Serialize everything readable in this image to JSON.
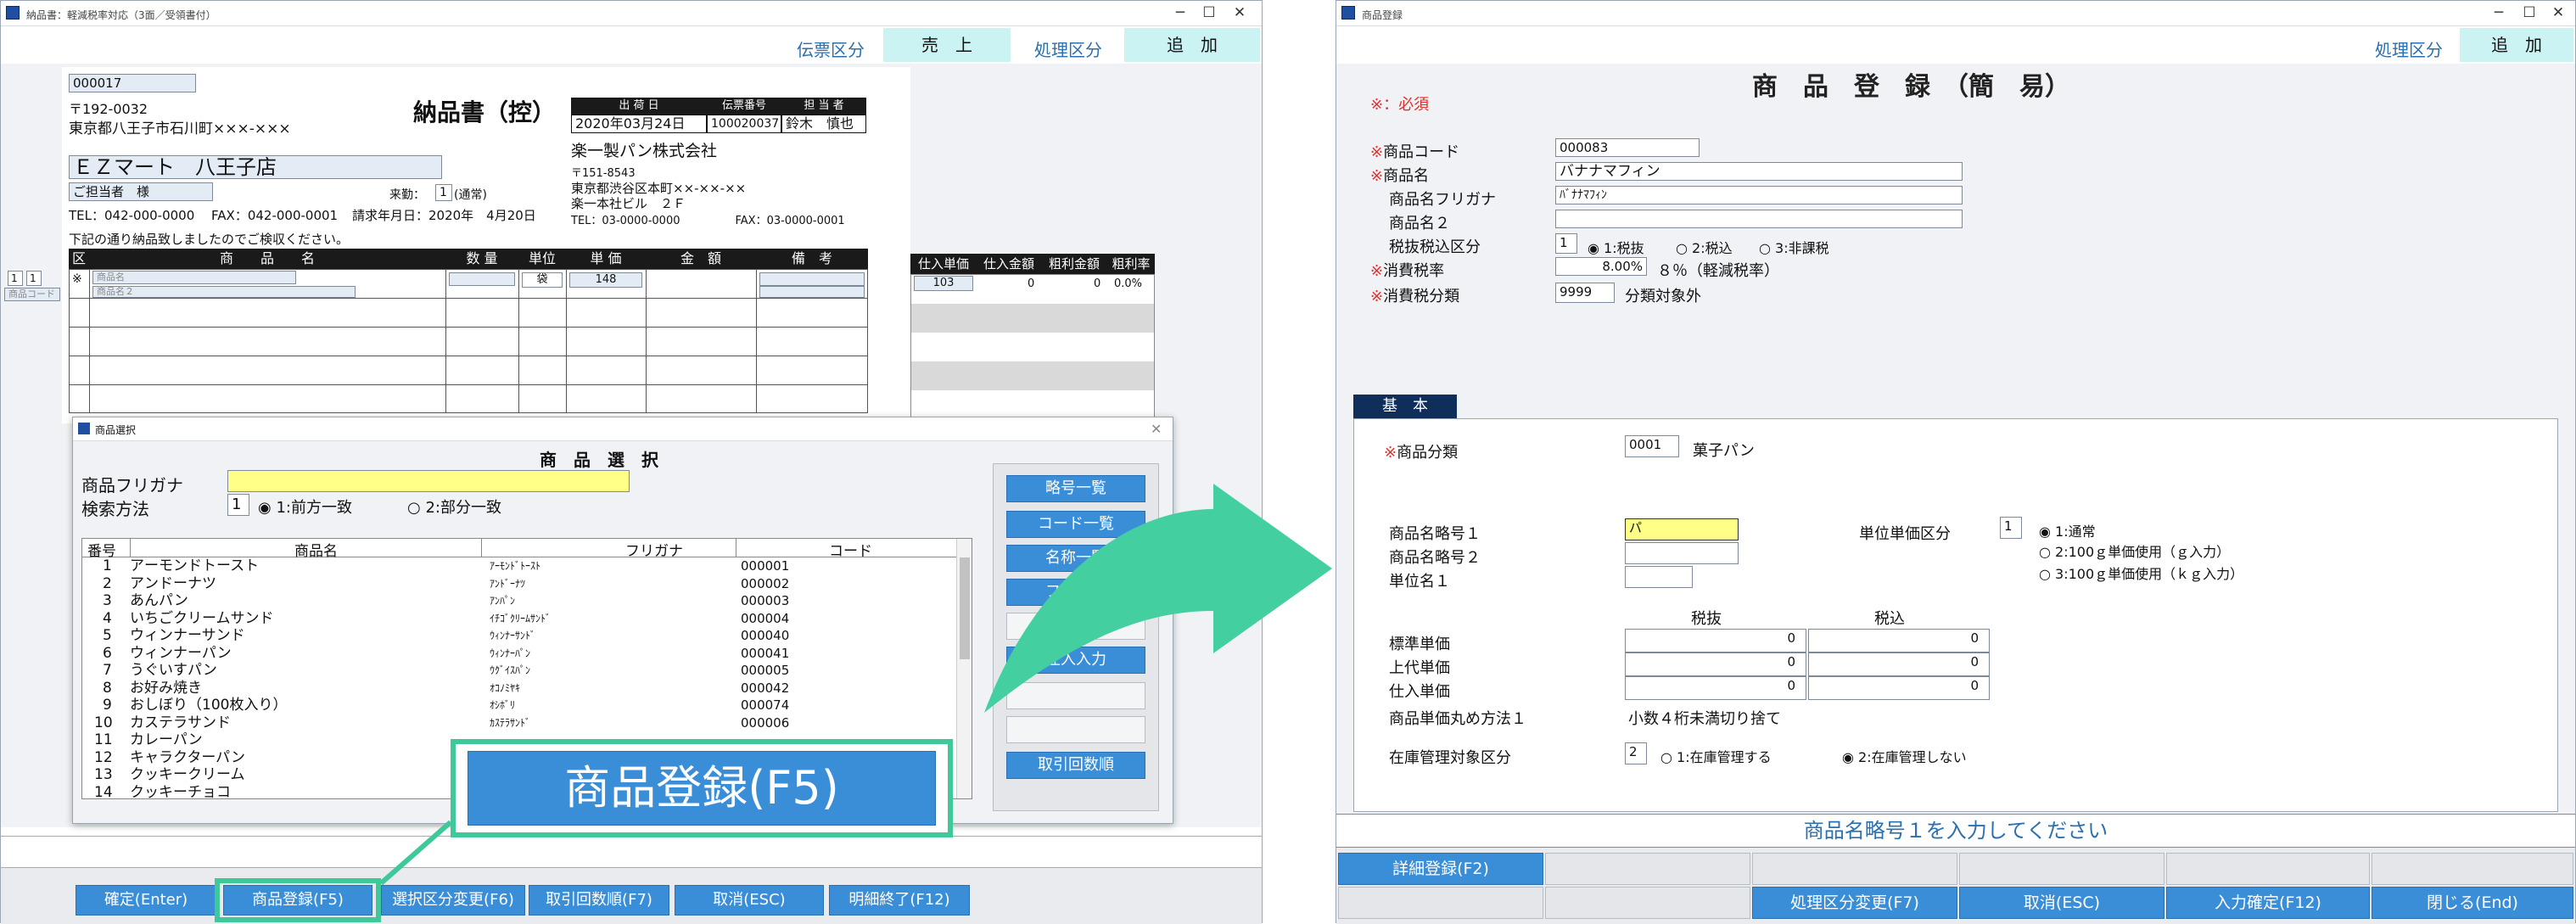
{
  "left_window": {
    "title": "納品書：軽減税率対応（3面／受領書付）",
    "header": {
      "denpyo_label": "伝票区分",
      "denpyo_value": "売　上",
      "shori_label": "処理区分",
      "shori_value": "追　加"
    },
    "customer_code": "000017",
    "postal": "〒192-0032",
    "address": "東京都八王子市石川町×××-×××",
    "doc_title": "納品書（控）",
    "info_headers": [
      "出 荷 日",
      "伝票番号",
      "担 当 者"
    ],
    "ship_date": "2020年03月24日",
    "slip_no": "100020037",
    "staff": "鈴木　慎也",
    "shop_name": "ＥＺマート　八王子店",
    "contact": "ご担当者　様",
    "raiten_label": "来勤：",
    "raiten_value": "1",
    "raiten_note": "(通常)",
    "bill_date": "請求年月日：2020年　4月20日",
    "tel_fax": "TEL：042-000-0000　 FAX：042-000-0001",
    "company_name": "楽一製パン株式会社",
    "company_postal": "〒151-8543",
    "company_address1": "東京都渋谷区本町××-××-××",
    "company_address2": "楽一本社ビル　２Ｆ",
    "company_tel": "TEL：03-0000-0000　　　　　FAX：03-0000-0001",
    "notice": "下記の通り納品致しましたのでご検収ください。",
    "table_headers": [
      "区",
      "商　　品　　名",
      "数 量",
      "単位",
      "単 価",
      "金　額",
      "備　考"
    ],
    "row_prefix": "※",
    "row_placeholder1": "商品名",
    "row_placeholder2": "商品名２",
    "row_unit": "袋",
    "row_price": "148",
    "side_headers": [
      "仕入単価",
      "仕入金額",
      "粗利金額",
      "粗利率"
    ],
    "side_values": [
      "103",
      "0",
      "0",
      "0.0%"
    ],
    "left_markers": [
      "1",
      "1"
    ],
    "left_code_label": "商品コード"
  },
  "dialog": {
    "title": "商品選択",
    "heading": "商　品　選　択",
    "furigana_label": "商品フリガナ",
    "search_label": "検索方法",
    "search_value": "1",
    "radio1": "1:前方一致",
    "radio2": "2:部分一致",
    "list_headers": [
      "番号",
      "商品名",
      "フリガナ",
      "コード"
    ],
    "rows": [
      [
        "1",
        "アーモンドトースト",
        "ｱｰﾓﾝﾄﾞﾄｰｽﾄ",
        "000001"
      ],
      [
        "2",
        "アンドーナツ",
        "ｱﾝﾄﾞｰﾅﾂ",
        "000002"
      ],
      [
        "3",
        "あんパン",
        "ｱﾝﾊﾟﾝ",
        "000003"
      ],
      [
        "4",
        "いちごクリームサンド",
        "ｲﾁｺﾞｸﾘｰﾑｻﾝﾄﾞ",
        "000004"
      ],
      [
        "5",
        "ウィンナーサンド",
        "ｳｨﾝﾅｰｻﾝﾄﾞ",
        "000040"
      ],
      [
        "6",
        "ウィンナーパン",
        "ｳｨﾝﾅｰﾊﾟﾝ",
        "000041"
      ],
      [
        "7",
        "うぐいすパン",
        "ｳｸﾞｲｽﾊﾟﾝ",
        "000005"
      ],
      [
        "8",
        "お好み焼き",
        "ｵｺﾉﾐﾔｷ",
        "000042"
      ],
      [
        "9",
        "おしぼり（100枚入り）",
        "ｵｼﾎﾞﾘ",
        "000074"
      ],
      [
        "10",
        "カステラサンド",
        "ｶｽﾃﾗｻﾝﾄﾞ",
        "000006"
      ],
      [
        "11",
        "カレーパン",
        "",
        ""
      ],
      [
        "12",
        "キャラクターパン",
        "",
        ""
      ],
      [
        "13",
        "クッキークリーム",
        "",
        ""
      ],
      [
        "14",
        "クッキーチョコ",
        "",
        ""
      ]
    ],
    "side_buttons": [
      "略号一覧",
      "コード一覧",
      "名称一覧",
      "フリガナ",
      "",
      "仕入入力",
      "",
      "",
      "取引回数順"
    ],
    "callout": "商品登録(F5)"
  },
  "left_fkeys": [
    "確定(Enter)",
    "商品登録(F5)",
    "選択区分変更(F6)",
    "取引回数順(F7)",
    "取消(ESC)",
    "明細終了(F12)"
  ],
  "right_window": {
    "title": "商品登録",
    "shori_label": "処理区分",
    "shori_value": "追　加",
    "required_note": "※：必須",
    "heading": "商　品　登　録　（簡　易）",
    "fields": {
      "code_label": "商品コード",
      "code": "000083",
      "name_label": "商品名",
      "name": "バナナマフィン",
      "furi_label": "商品名フリガナ",
      "furi": "ﾊﾞﾅﾅﾏﾌｨﾝ",
      "name2_label": "商品名２",
      "name2": "",
      "tax_kbn_label": "税抜税込区分",
      "tax_kbn": "1",
      "tax_opt1": "1:税抜",
      "tax_opt2": "2:税込",
      "tax_opt3": "3:非課税",
      "tax_rate_label": "消費税率",
      "tax_rate": "8.00%",
      "tax_rate_note": "８％（軽減税率）",
      "tax_cls_label": "消費税分類",
      "tax_cls": "9999",
      "tax_cls_note": "分類対象外"
    },
    "tab": "基　本",
    "basic": {
      "cat_label": "商品分類",
      "cat_code": "0001",
      "cat_name": "菓子パン",
      "abbr1_label": "商品名略号１",
      "abbr1": "パ",
      "abbr2_label": "商品名略号２",
      "unit_label": "単位名１",
      "unitprice_kbn_label": "単位単価区分",
      "unitprice_kbn": "1",
      "up_opt1": "1:通常",
      "up_opt2": "2:100ｇ単価使用（ｇ入力）",
      "up_opt3": "3:100ｇ単価使用（ｋｇ入力）",
      "col_zeinuki": "税抜",
      "col_zeikomi": "税込",
      "std_label": "標準単価",
      "jodai_label": "上代単価",
      "shiire_label": "仕入単価",
      "std": [
        "0",
        "0"
      ],
      "jodai": [
        "0",
        "0"
      ],
      "shiire": [
        "0",
        "0"
      ],
      "round_label": "商品単価丸め方法１",
      "round_value": "小数４桁未満切り捨て",
      "stock_label": "在庫管理対象区分",
      "stock_value": "2",
      "stock_opt1": "1:在庫管理する",
      "stock_opt2": "2:在庫管理しない"
    },
    "status_msg": "商品名略号１を入力してください",
    "fkeys_row1": [
      "詳細登録(F2)"
    ],
    "fkeys_row2": [
      "処理区分変更(F7)",
      "取消(ESC)",
      "入力確定(F12)",
      "閉じる(End)"
    ]
  }
}
